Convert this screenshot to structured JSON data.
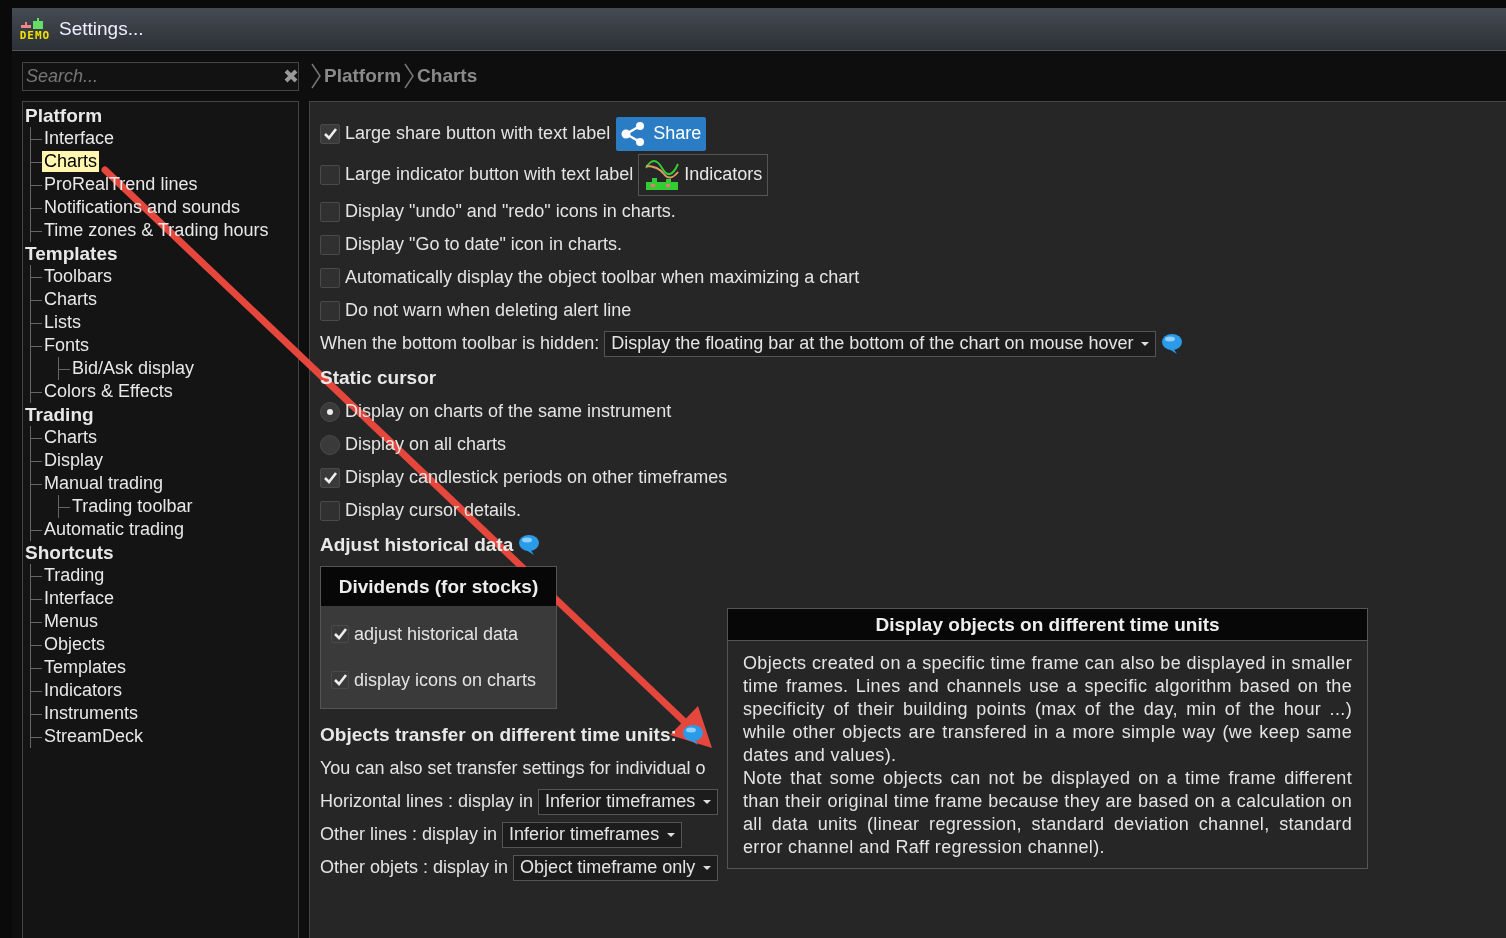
{
  "window": {
    "title": "Settings...",
    "logo_text": "DEMO"
  },
  "search": {
    "placeholder": "Search..."
  },
  "breadcrumb": [
    "Platform",
    "Charts"
  ],
  "sidebar": {
    "items": [
      {
        "label": "Platform",
        "selected": false,
        "children": [
          {
            "label": "Interface",
            "selected": false
          },
          {
            "label": "Charts",
            "selected": true
          },
          {
            "label": "ProRealTrend lines",
            "selected": false
          },
          {
            "label": "Notifications and sounds",
            "selected": false
          },
          {
            "label": "Time zones & Trading hours",
            "selected": false
          }
        ]
      },
      {
        "label": "Templates",
        "selected": false,
        "children": [
          {
            "label": "Toolbars",
            "selected": false
          },
          {
            "label": "Charts",
            "selected": false
          },
          {
            "label": "Lists",
            "selected": false
          },
          {
            "label": "Fonts",
            "selected": false,
            "children": [
              {
                "label": "Bid/Ask display",
                "selected": false
              }
            ]
          },
          {
            "label": "Colors & Effects",
            "selected": false
          }
        ]
      },
      {
        "label": "Trading",
        "selected": false,
        "children": [
          {
            "label": "Charts",
            "selected": false
          },
          {
            "label": "Display",
            "selected": false
          },
          {
            "label": "Manual trading",
            "selected": false,
            "children": [
              {
                "label": "Trading toolbar",
                "selected": false
              }
            ]
          },
          {
            "label": "Automatic trading",
            "selected": false
          }
        ]
      },
      {
        "label": "Shortcuts",
        "selected": false,
        "children": [
          {
            "label": "Trading",
            "selected": false
          },
          {
            "label": "Interface",
            "selected": false
          },
          {
            "label": "Menus",
            "selected": false
          },
          {
            "label": "Objects",
            "selected": false
          },
          {
            "label": "Templates",
            "selected": false
          },
          {
            "label": "Indicators",
            "selected": false
          },
          {
            "label": "Instruments",
            "selected": false
          },
          {
            "label": "StreamDeck",
            "selected": false
          }
        ]
      }
    ]
  },
  "settings": [
    {
      "kind": "checkbox",
      "label": "Large share button with text label",
      "checked": true,
      "sample": {
        "kind": "share",
        "label": "Share"
      }
    },
    {
      "kind": "checkbox",
      "label": "Large indicator button with text label",
      "checked": false,
      "sample": {
        "kind": "indicators",
        "label": "Indicators"
      }
    },
    {
      "kind": "checkbox",
      "label": "Display \"undo\" and \"redo\" icons in charts.",
      "checked": false
    },
    {
      "kind": "checkbox",
      "label": "Display \"Go to date\" icon in charts.",
      "checked": false
    },
    {
      "kind": "checkbox",
      "label": "Automatically display the object toolbar when maximizing a chart",
      "checked": false
    },
    {
      "kind": "checkbox",
      "label": "Do not warn when deleting alert line",
      "checked": false
    },
    {
      "kind": "select",
      "label": "When the bottom toolbar is hidden:",
      "value": "Display the floating bar at the bottom of the chart on mouse hover",
      "info": true
    },
    {
      "kind": "heading",
      "label": "Static cursor",
      "info": false
    },
    {
      "kind": "radio",
      "label": "Display on charts of the same instrument",
      "selected": true
    },
    {
      "kind": "radio",
      "label": "Display on all charts",
      "selected": false
    },
    {
      "kind": "checkbox",
      "label": "Display candlestick periods on other timeframes",
      "checked": true
    },
    {
      "kind": "checkbox",
      "label": "Display cursor details.",
      "checked": false
    },
    {
      "kind": "heading",
      "label": "Adjust historical data",
      "info": true
    },
    {
      "kind": "group",
      "title": "Dividends (for stocks)",
      "items": [
        {
          "label": "adjust historical data",
          "checked": true
        },
        {
          "label": "display icons on charts",
          "checked": true
        }
      ]
    },
    {
      "kind": "heading",
      "label": "Objects transfer on different time units:",
      "info": true
    },
    {
      "kind": "text",
      "label": "You can also set transfer settings for individual o"
    },
    {
      "kind": "select",
      "label": "Horizontal lines : display in",
      "value": "Inferior timeframes",
      "info": false
    },
    {
      "kind": "select",
      "label": "Other lines : display in",
      "value": "Inferior timeframes",
      "info": false
    },
    {
      "kind": "select",
      "label": "Other objets : display in",
      "value": "Object timeframe only",
      "info": false
    }
  ],
  "tooltip": {
    "title": "Display objects on different time units",
    "paragraphs": [
      "Objects created on a specific time frame can also be displayed in smaller time frames. Lines and channels use a specific algorithm based on the specificity of their building points (max of the day, min of the hour ...) while other objects are transfered in a more simple way (we keep same dates and values).",
      "Note that some objects can not be displayed on a time frame different than their original time frame because they are based on a calculation on all data units (linear regression, standard deviation channel, standard error channel and Raff regression channel)."
    ]
  }
}
